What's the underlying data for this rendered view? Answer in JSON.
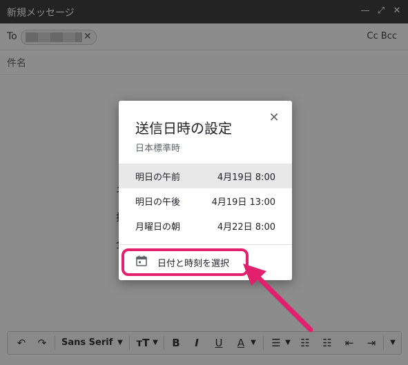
{
  "window": {
    "title": "新規メッセージ",
    "minimize_icon": "minimize-icon",
    "expand_icon": "expand-icon",
    "close_icon": "close-icon"
  },
  "compose": {
    "to_label": "To",
    "recipient_chip_remove": "✕",
    "cc_bcc": "Cc Bcc",
    "subject_placeholder": "件名",
    "body_partial_chars": [
      "ネ",
      "排",
      "全"
    ]
  },
  "toolbar": {
    "font": "Sans Serif",
    "bold": "B",
    "italic": "I",
    "underline": "U",
    "text_color": "A"
  },
  "dialog": {
    "title": "送信日時の設定",
    "timezone": "日本標準時",
    "close": "✕",
    "options": [
      {
        "label": "明日の午前",
        "time": "4月19日 8:00",
        "selected": true
      },
      {
        "label": "明日の午後",
        "time": "4月19日 13:00",
        "selected": false
      },
      {
        "label": "月曜日の朝",
        "time": "4月22日 8:00",
        "selected": false
      }
    ],
    "pick_label": "日付と時刻を選択",
    "pick_icon": "calendar-icon"
  },
  "colors": {
    "titlebar": "#404040",
    "highlight": "#e3206d",
    "selected_row": "#e8e8e8"
  }
}
